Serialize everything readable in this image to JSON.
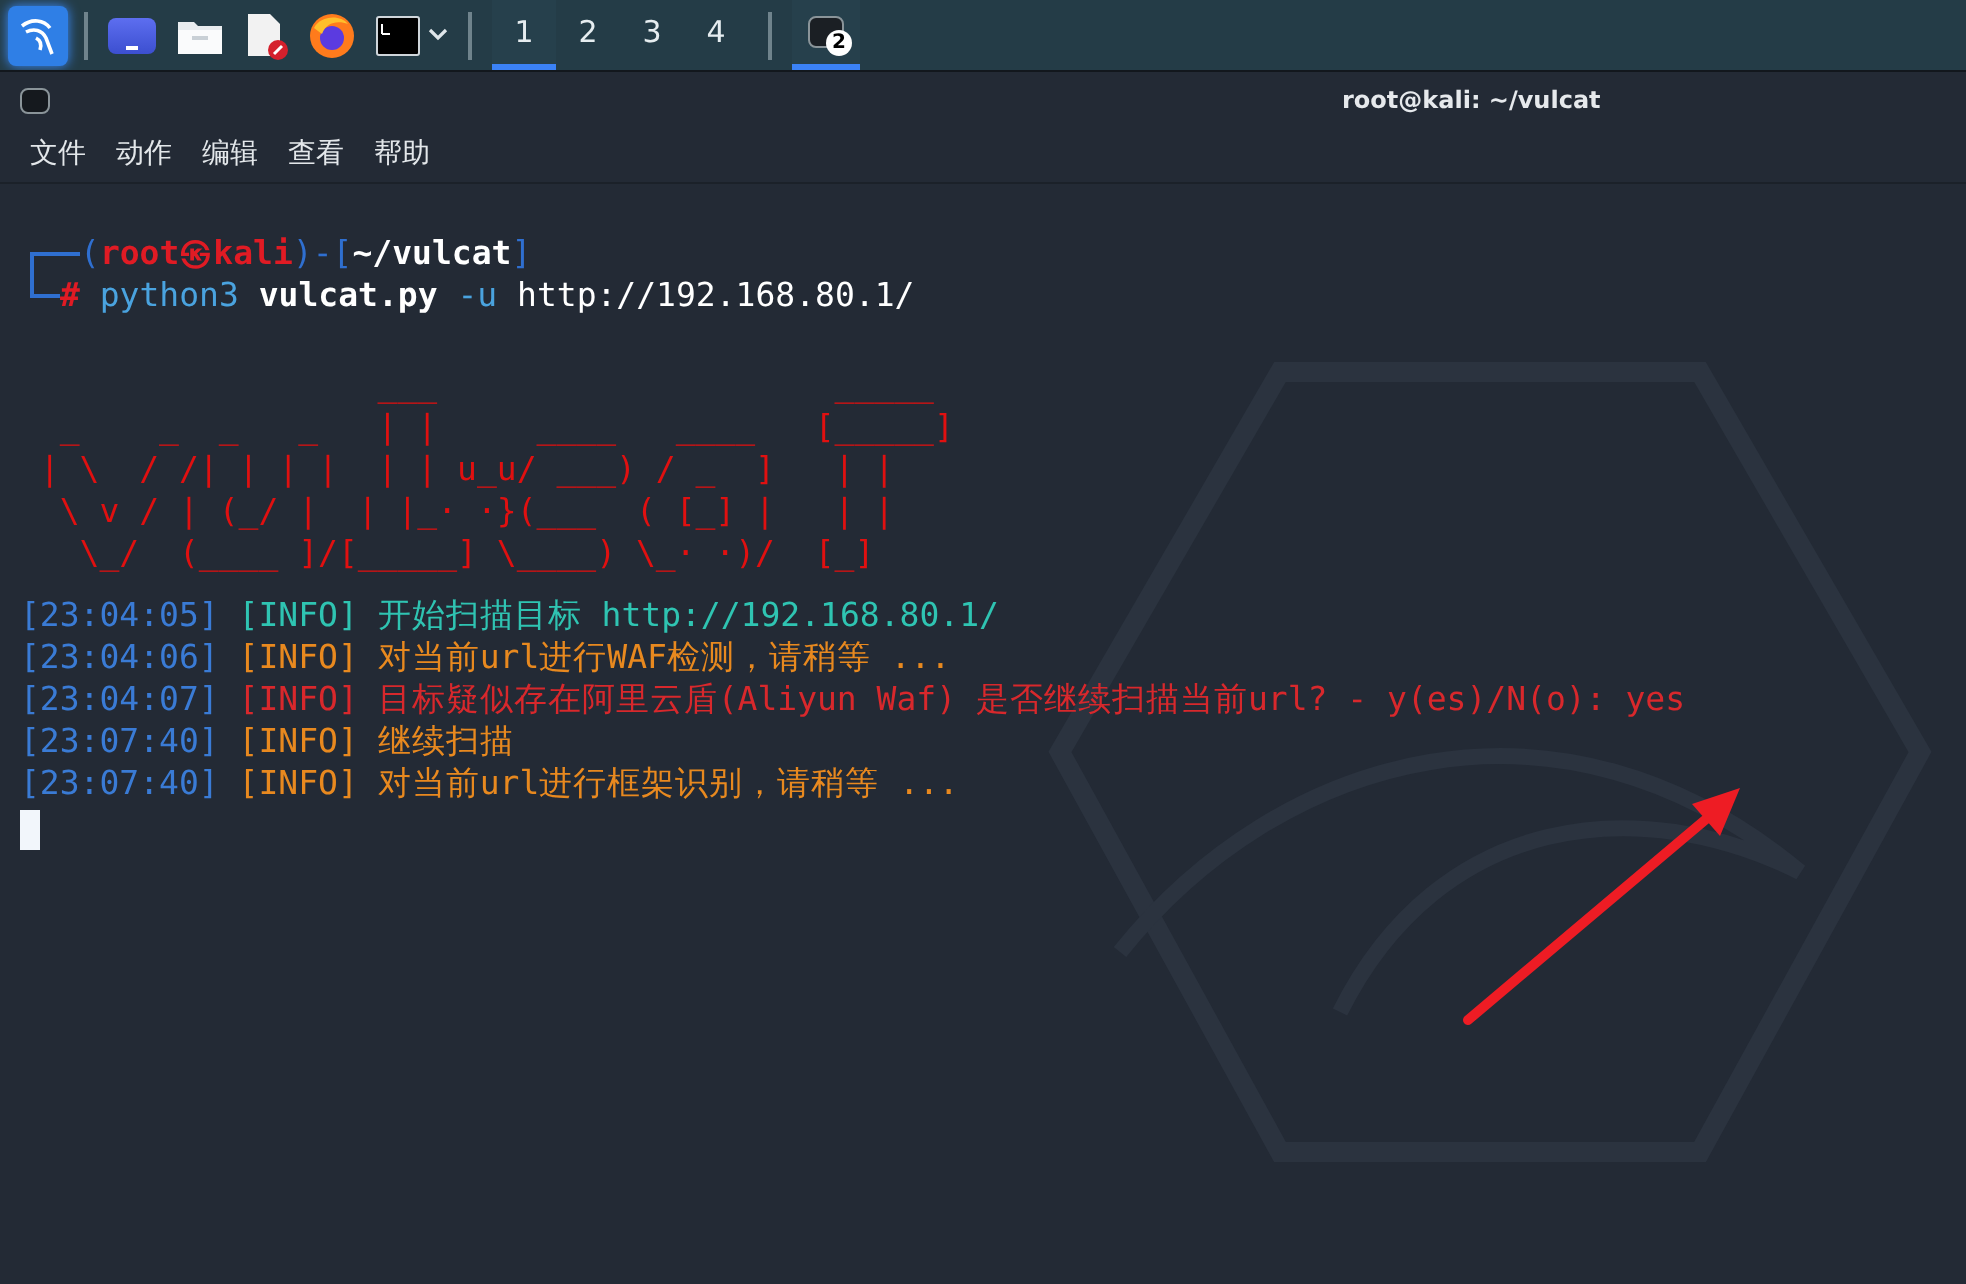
{
  "taskbar": {
    "launchers": [
      {
        "kind": "menu"
      },
      {
        "kind": "desktop"
      },
      {
        "kind": "files"
      },
      {
        "kind": "editor"
      },
      {
        "kind": "browser"
      },
      {
        "kind": "terminal"
      }
    ],
    "workspaces": [
      {
        "label": "1",
        "selected": true
      },
      {
        "label": "2",
        "selected": false
      },
      {
        "label": "3",
        "selected": false
      },
      {
        "label": "4",
        "selected": false
      }
    ],
    "task": {
      "badge": "2",
      "selected": true
    }
  },
  "window": {
    "title": "root@kali: ~/vulcat"
  },
  "menu": [
    "文件",
    "动作",
    "编辑",
    "查看",
    "帮助"
  ],
  "prompt": {
    "open": "(",
    "user": "root㉿kali",
    "close": ")-[",
    "path": "~/vulcat",
    "end": "]",
    "symbol": "#",
    "command": "python3",
    "script": "vulcat.py",
    "flag": "-u",
    "url": "http://192.168.80.1/"
  },
  "banner": [
    "                  ___                    _____",
    "  _    _  _   _   | |     ____   ____   [_____]",
    " | \\  / /| | | |  | | u_u/ ___) / _  ]   | |",
    "  \\ v / | (_/ |  | |_· ·}(___  ( [_] |   | |",
    "   \\_/  (____ ]/[_____] \\____) \\_· ·)/  [_]"
  ],
  "log": [
    {
      "time": "[23:04:05]",
      "tag": "[INFO]",
      "message": "开始扫描目标 http://192.168.80.1/",
      "kind": "success"
    },
    {
      "time": "[23:04:06]",
      "tag": "[INFO]",
      "message": "对当前url进行WAF检测，请稍等 ...",
      "kind": "warning"
    },
    {
      "time": "[23:04:07]",
      "tag": "[INFO]",
      "message": "目标疑似存在阿里云盾(Aliyun Waf) 是否继续扫描当前url? - y(es)/N(o): yes",
      "kind": "error"
    },
    {
      "time": "[23:07:40]",
      "tag": "[INFO]",
      "message": "继续扫描",
      "kind": "warning"
    },
    {
      "time": "[23:07:40]",
      "tag": "[INFO]",
      "message": "对当前url进行框架识别，请稍等 ...",
      "kind": "warning"
    }
  ]
}
